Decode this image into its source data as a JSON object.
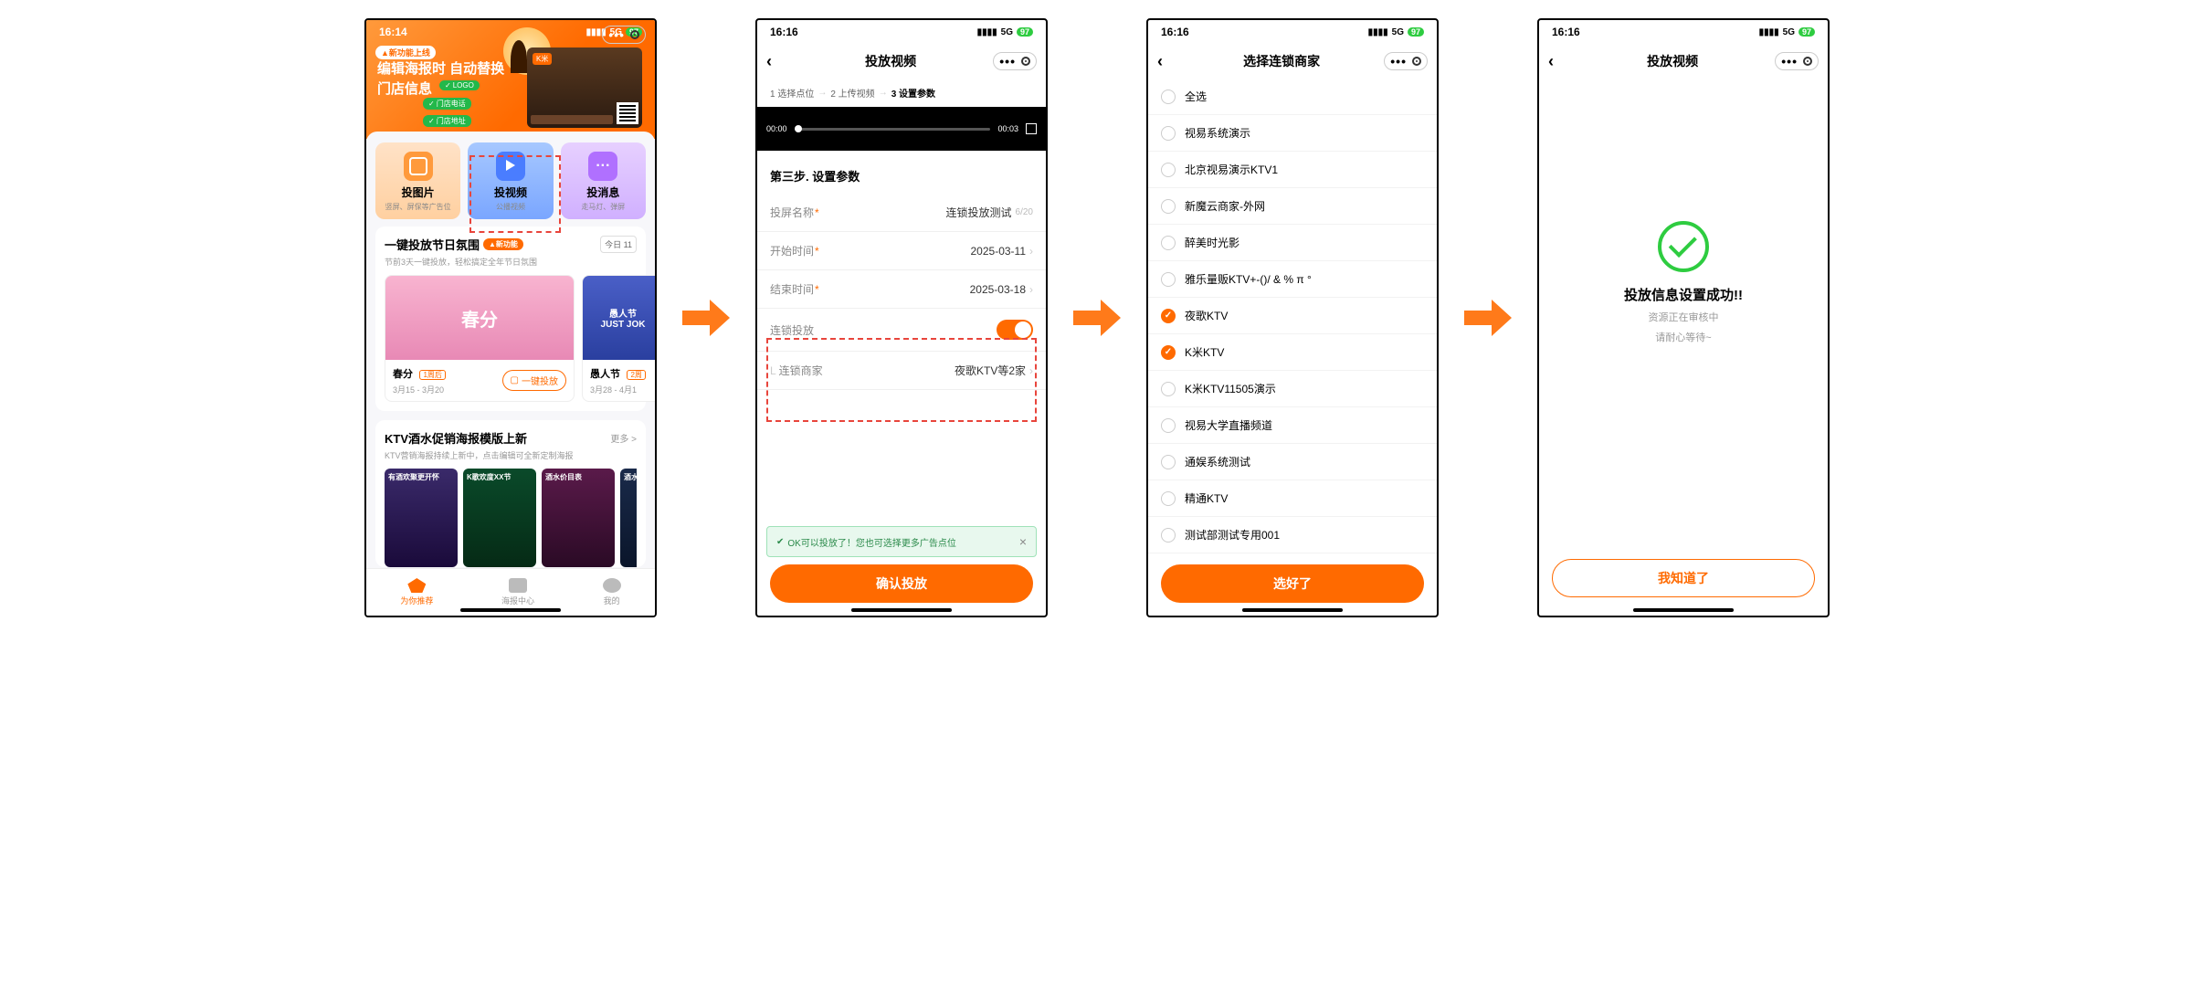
{
  "status": {
    "time": "16:14",
    "time2": "16:16",
    "network": "5G",
    "battery": "97"
  },
  "s1": {
    "newbadge": "▲新功能上线",
    "headline1": "编辑海报时 自动替换",
    "headline2": "门店信息",
    "tags": {
      "logo": "LOGO",
      "phone": "门店电话",
      "addr": "门店地址",
      "qr": "二维码"
    },
    "km": "K米",
    "cards": {
      "pic": {
        "title": "投图片",
        "sub": "竖屏、屏保等广告位"
      },
      "vid": {
        "title": "投视频",
        "sub": "公播视频"
      },
      "msg": {
        "title": "投消息",
        "sub": "走马灯、弹屏"
      }
    },
    "festival": {
      "title": "一键投放节日氛围",
      "badge": "▲新功能",
      "sub": "节前3天一键投放，轻松搞定全年节日氛围",
      "today": "今日 11",
      "items": [
        {
          "img": "春分",
          "name": "春分",
          "tag": "1周后",
          "date": "3月15 - 3月20",
          "btn": "一键投放"
        },
        {
          "img": "愚人节\nJUST JOK",
          "name": "愚人节",
          "tag": "2周",
          "date": "3月28 - 4月1"
        }
      ]
    },
    "posters": {
      "title": "KTV酒水促销海报模版上新",
      "more": "更多 >",
      "sub": "KTV营销海报持续上新中，点击编辑可全新定制海报",
      "items": [
        "有酒欢聚更开怀",
        "K歌欢度XX节",
        "酒水价目表",
        "酒水"
      ]
    },
    "tabs": [
      "为你推荐",
      "海报中心",
      "我的"
    ]
  },
  "s2": {
    "title": "投放视频",
    "steps": [
      "1 选择点位",
      "2 上传视频",
      "3 设置参数"
    ],
    "video": {
      "start": "00:00",
      "end": "00:03"
    },
    "step_title": "第三步. 设置参数",
    "fields": {
      "name": {
        "label": "投屏名称",
        "value": "连锁投放测试",
        "count": "6/20"
      },
      "start": {
        "label": "开始时间",
        "value": "2025-03-11"
      },
      "end": {
        "label": "结束时间",
        "value": "2025-03-18"
      },
      "chain": {
        "label": "连锁投放"
      },
      "merchant": {
        "label": "连锁商家",
        "value": "夜歌KTV等2家"
      }
    },
    "toast": "OK可以投放了！您也可选择更多广告点位",
    "btn": "确认投放"
  },
  "s3": {
    "title": "选择连锁商家",
    "all": "全选",
    "items": [
      {
        "name": "视易系统演示",
        "on": false
      },
      {
        "name": "北京视易演示KTV1",
        "on": false
      },
      {
        "name": "新魔云商家-外网",
        "on": false
      },
      {
        "name": "醉美时光影",
        "on": false
      },
      {
        "name": "雅乐量贩KTV+-()/ & % π °",
        "on": false
      },
      {
        "name": "夜歌KTV",
        "on": true
      },
      {
        "name": "K米KTV",
        "on": true
      },
      {
        "name": "K米KTV11505演示",
        "on": false
      },
      {
        "name": "视易大学直播频道",
        "on": false
      },
      {
        "name": "通娱系统测试",
        "on": false
      },
      {
        "name": "精通KTV",
        "on": false
      },
      {
        "name": "测试部测试专用001",
        "on": false
      }
    ],
    "btn": "选好了"
  },
  "s4": {
    "title": "投放视频",
    "heading": "投放信息设置成功!!",
    "line1": "资源正在审核中",
    "line2": "请耐心等待~",
    "btn": "我知道了"
  }
}
